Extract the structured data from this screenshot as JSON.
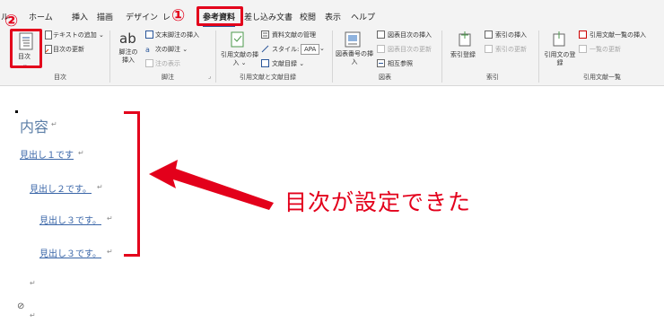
{
  "tabs": [
    "ル",
    "ホーム",
    "挿入",
    "描画",
    "デザイン",
    "レ",
    "参考資料",
    "差し込み文書",
    "校閲",
    "表示",
    "ヘルプ"
  ],
  "markers": {
    "one": "①",
    "two": "②"
  },
  "ribbon": {
    "toc_button": "目次",
    "add_text": "テキストの追加 ⌄",
    "update_toc": "目次の更新",
    "group_toc": "目次",
    "insert_footnote": "脚注の挿入",
    "footnote_icon_text": "ab",
    "insert_endnote": "文末脚注の挿入",
    "next_footnote": "次の脚注 ⌄",
    "show_notes": "注の表示",
    "group_footnotes": "脚注",
    "insert_citation": "引用文献の挿入 ⌄",
    "manage_sources": "資料文献の管理",
    "style_label": "スタイル:",
    "style_value": "APA",
    "bibliography": "文献目録 ⌄",
    "group_citations": "引用文献と文献目録",
    "insert_caption": "図表番号の挿入",
    "insert_table_of_figures": "図表目次の挿入",
    "update_table": "図表目次の更新",
    "cross_reference": "相互参照",
    "group_captions": "図表",
    "mark_entry": "索引登録",
    "insert_index": "索引の挿入",
    "update_index": "索引の更新",
    "group_index": "索引",
    "mark_citation": "引用文の登録",
    "insert_table_of_authorities": "引用文献一覧の挿入",
    "update_table_auth": "一覧の更新",
    "group_authorities": "引用文献一覧"
  },
  "document": {
    "toc_title": "内容",
    "entries": [
      "見出し１です",
      "見出し２です。",
      "見出し３です。",
      "見出し３です。"
    ],
    "para_mark": "↵",
    "anchor": "⊘"
  },
  "annotation": {
    "callout": "目次が設定できた"
  },
  "colors": {
    "accent_red": "#e3001b",
    "link_blue": "#3a66a8",
    "title_blue": "#5b7ea7"
  }
}
